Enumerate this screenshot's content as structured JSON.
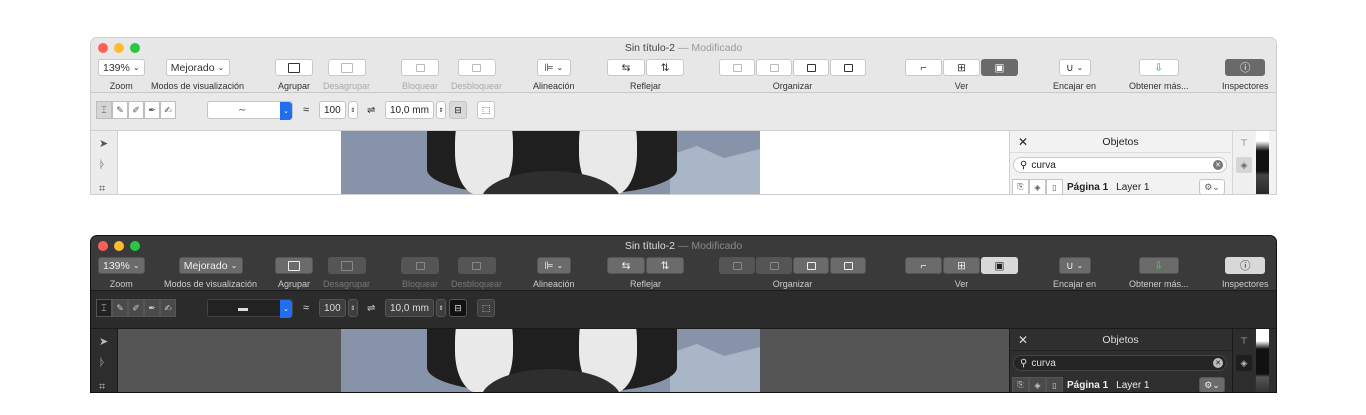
{
  "window": {
    "title": "Sin título-2",
    "separator": "—",
    "status": "Modificado"
  },
  "toolbar": {
    "zoom": {
      "value": "139%",
      "label": "Zoom"
    },
    "view_mode": {
      "value": "Mejorado",
      "label": "Modos de visualización"
    },
    "group": {
      "label": "Agrupar"
    },
    "ungroup": {
      "label": "Desagrupar"
    },
    "lock": {
      "label": "Bloquear"
    },
    "unlock": {
      "label": "Desbloquear"
    },
    "align": {
      "label": "Alineación"
    },
    "reflect": {
      "label": "Reflejar"
    },
    "arrange": {
      "label": "Organizar"
    },
    "view": {
      "label": "Ver"
    },
    "snap": {
      "label": "Encajar en"
    },
    "get_more": {
      "label": "Obtener más..."
    },
    "inspectors": {
      "label": "Inspectores"
    }
  },
  "secondary": {
    "opacity": "100",
    "width": "10,0 mm"
  },
  "objects_panel": {
    "title": "Objetos",
    "search_value": "curva",
    "page_label": "Página 1",
    "layer_label": "Layer 1"
  },
  "themes": [
    "light",
    "dark"
  ]
}
